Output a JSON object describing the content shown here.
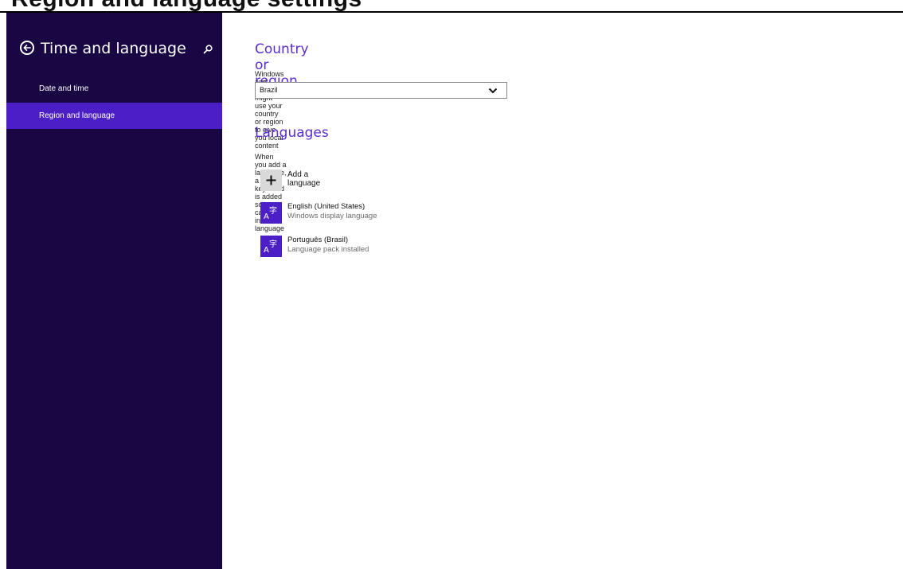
{
  "overlay": {
    "clipped_title": "Region and language settings"
  },
  "sidebar": {
    "title": "Time and language",
    "items": [
      {
        "label": "Date and time",
        "active": false
      },
      {
        "label": "Region and language",
        "active": true
      }
    ]
  },
  "country": {
    "heading": "Country or region",
    "description": "Windows and apps might use your country or region to give you local content",
    "selected": "Brazil"
  },
  "languages": {
    "heading": "Languages",
    "description": "When you add a language, a keyboard is added so you can type in that language",
    "add_label": "Add a language",
    "list": [
      {
        "name": "English (United States)",
        "status": "Windows display language"
      },
      {
        "name": "Português (Brasil)",
        "status": "Language pack installed"
      }
    ]
  },
  "colors": {
    "sidebar_bg": "#180742",
    "accent": "#4c1ec6",
    "heading": "#5a2ccf"
  },
  "icons": {
    "back": "back-arrow-icon",
    "search": "search-icon",
    "dropdown": "chevron-down-icon",
    "add": "plus-icon",
    "language": "language-character-icon"
  }
}
